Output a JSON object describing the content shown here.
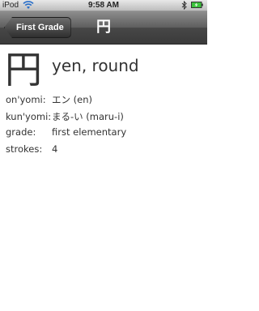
{
  "status_bar": {
    "carrier": "iPod",
    "time": "9:58 AM",
    "wifi_icon": "wifi-icon",
    "bluetooth_icon": "bluetooth-icon",
    "battery_icon": "battery-charging-icon",
    "battery_color": "#3cc23c"
  },
  "nav": {
    "back_label": "First Grade",
    "title": "円"
  },
  "detail": {
    "kanji": "円",
    "meaning": "yen, round",
    "rows": [
      {
        "label": "on'yomi:",
        "value": "エン (en)"
      },
      {
        "label": "kun'yomi:",
        "value": "まる-い (maru-i)"
      },
      {
        "label": "grade:",
        "value": "first elementary"
      },
      {
        "label": "strokes:",
        "value": "4"
      }
    ]
  }
}
